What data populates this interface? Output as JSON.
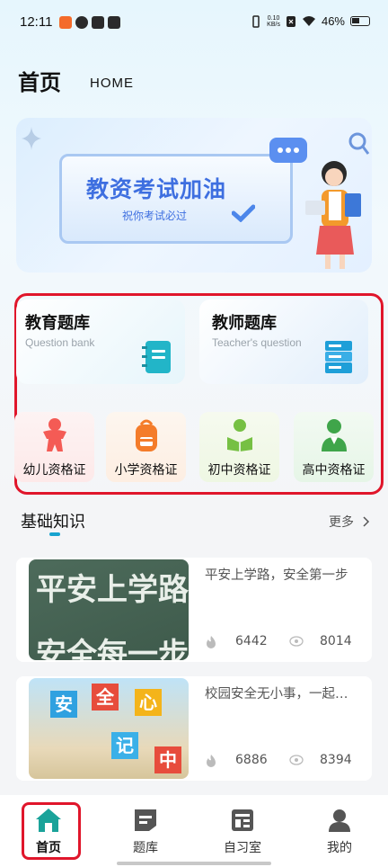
{
  "status_bar": {
    "time": "12:11",
    "network_speed_value": "0.10",
    "network_speed_unit": "KB/s",
    "battery": "46%",
    "icons": [
      "app-notification-icon",
      "cloud-icon",
      "mail-icon",
      "play-icon",
      "vibrate-icon",
      "close-box-icon",
      "wifi-icon",
      "battery-icon"
    ]
  },
  "header": {
    "title": "首页",
    "subtitle": "HOME"
  },
  "banner": {
    "title": "教资考试加油",
    "subtitle": "祝你考试必过"
  },
  "question_banks": [
    {
      "title": "教育题库",
      "subtitle": "Question bank",
      "icon": "notebook-icon",
      "bg": "#e8f5fb"
    },
    {
      "title": "教师题库",
      "subtitle": "Teacher's question",
      "icon": "books-icon",
      "bg": "#e4f0fb"
    }
  ],
  "certificates": [
    {
      "label": "幼儿资格证",
      "icon": "child-icon",
      "color": "#f45b55",
      "bg": "#fdecec"
    },
    {
      "label": "小学资格证",
      "icon": "backpack-icon",
      "color": "#f47c2a",
      "bg": "#fdf0e6"
    },
    {
      "label": "初中资格证",
      "icon": "reader-icon",
      "color": "#76c043",
      "bg": "#f1f8e6"
    },
    {
      "label": "高中资格证",
      "icon": "student-icon",
      "color": "#3fa54a",
      "bg": "#e9f6ea"
    }
  ],
  "section": {
    "title": "基础知识",
    "more": "更多"
  },
  "articles": [
    {
      "title": "平安上学路，安全第一步",
      "likes": "6442",
      "views": "8014",
      "thumb_text": [
        "平安上学路",
        "安全每一步"
      ]
    },
    {
      "title": "校园安全无小事，一起守护",
      "likes": "6886",
      "views": "8394",
      "thumb_text": [
        "安",
        "全",
        "心",
        "记",
        "中"
      ]
    }
  ],
  "bottom_nav": [
    {
      "label": "首页",
      "icon": "home-icon",
      "active": true
    },
    {
      "label": "题库",
      "icon": "question-bank-icon",
      "active": false
    },
    {
      "label": "自习室",
      "icon": "study-room-icon",
      "active": false
    },
    {
      "label": "我的",
      "icon": "profile-icon",
      "active": false
    }
  ],
  "colors": {
    "accent": "#1aa39a",
    "highlight": "#e0162b",
    "section_indicator": "#17a3cf"
  }
}
